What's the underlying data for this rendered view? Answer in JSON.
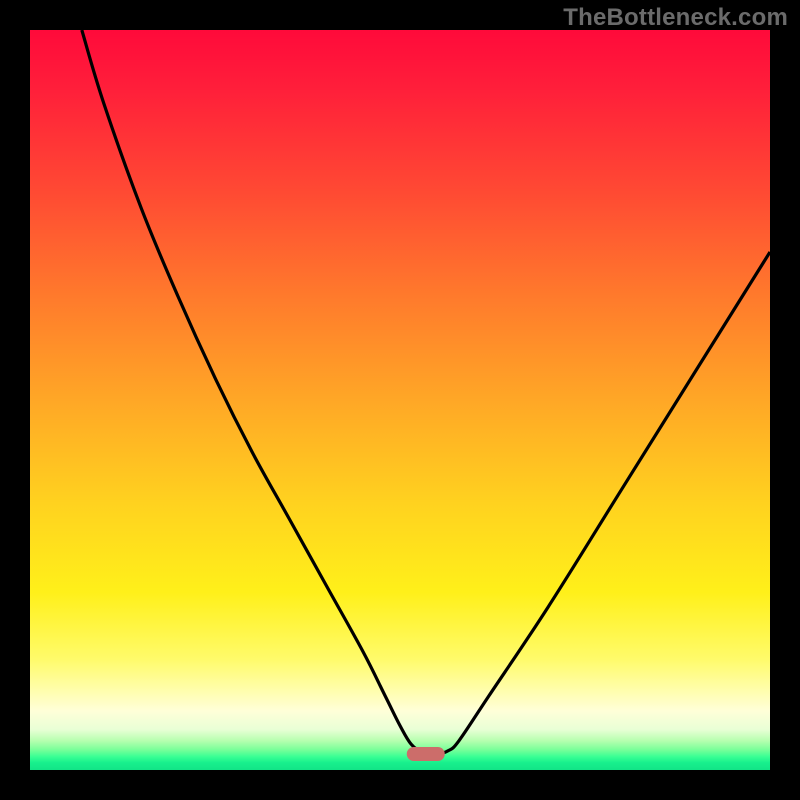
{
  "watermark": "TheBottleneck.com",
  "chart_data": {
    "type": "line",
    "title": "",
    "xlabel": "",
    "ylabel": "",
    "xlim": [
      0,
      100
    ],
    "ylim": [
      0,
      100
    ],
    "grid": false,
    "legend": false,
    "annotations": [],
    "series": [
      {
        "name": "curve",
        "x": [
          7,
          10,
          15,
          20,
          25,
          30,
          35,
          40,
          45,
          48,
          50,
          51.5,
          53,
          55,
          56.5,
          58,
          62,
          70,
          80,
          90,
          100
        ],
        "y": [
          100,
          90,
          76,
          64,
          53,
          43,
          34,
          25,
          16,
          10,
          6,
          3.5,
          2.5,
          2.2,
          2.6,
          4,
          10,
          22,
          38,
          54,
          70
        ]
      }
    ],
    "marker": {
      "x": 53.5,
      "y": 2.2,
      "width_pct": 5.2
    },
    "background_gradient": {
      "direction": "top-to-bottom",
      "stops": [
        {
          "pct": 0,
          "color": "#ff0a3a"
        },
        {
          "pct": 36,
          "color": "#ff7a2c"
        },
        {
          "pct": 64,
          "color": "#ffd21f"
        },
        {
          "pct": 92,
          "color": "#ffffd8"
        },
        {
          "pct": 100,
          "color": "#12e487"
        }
      ]
    }
  }
}
